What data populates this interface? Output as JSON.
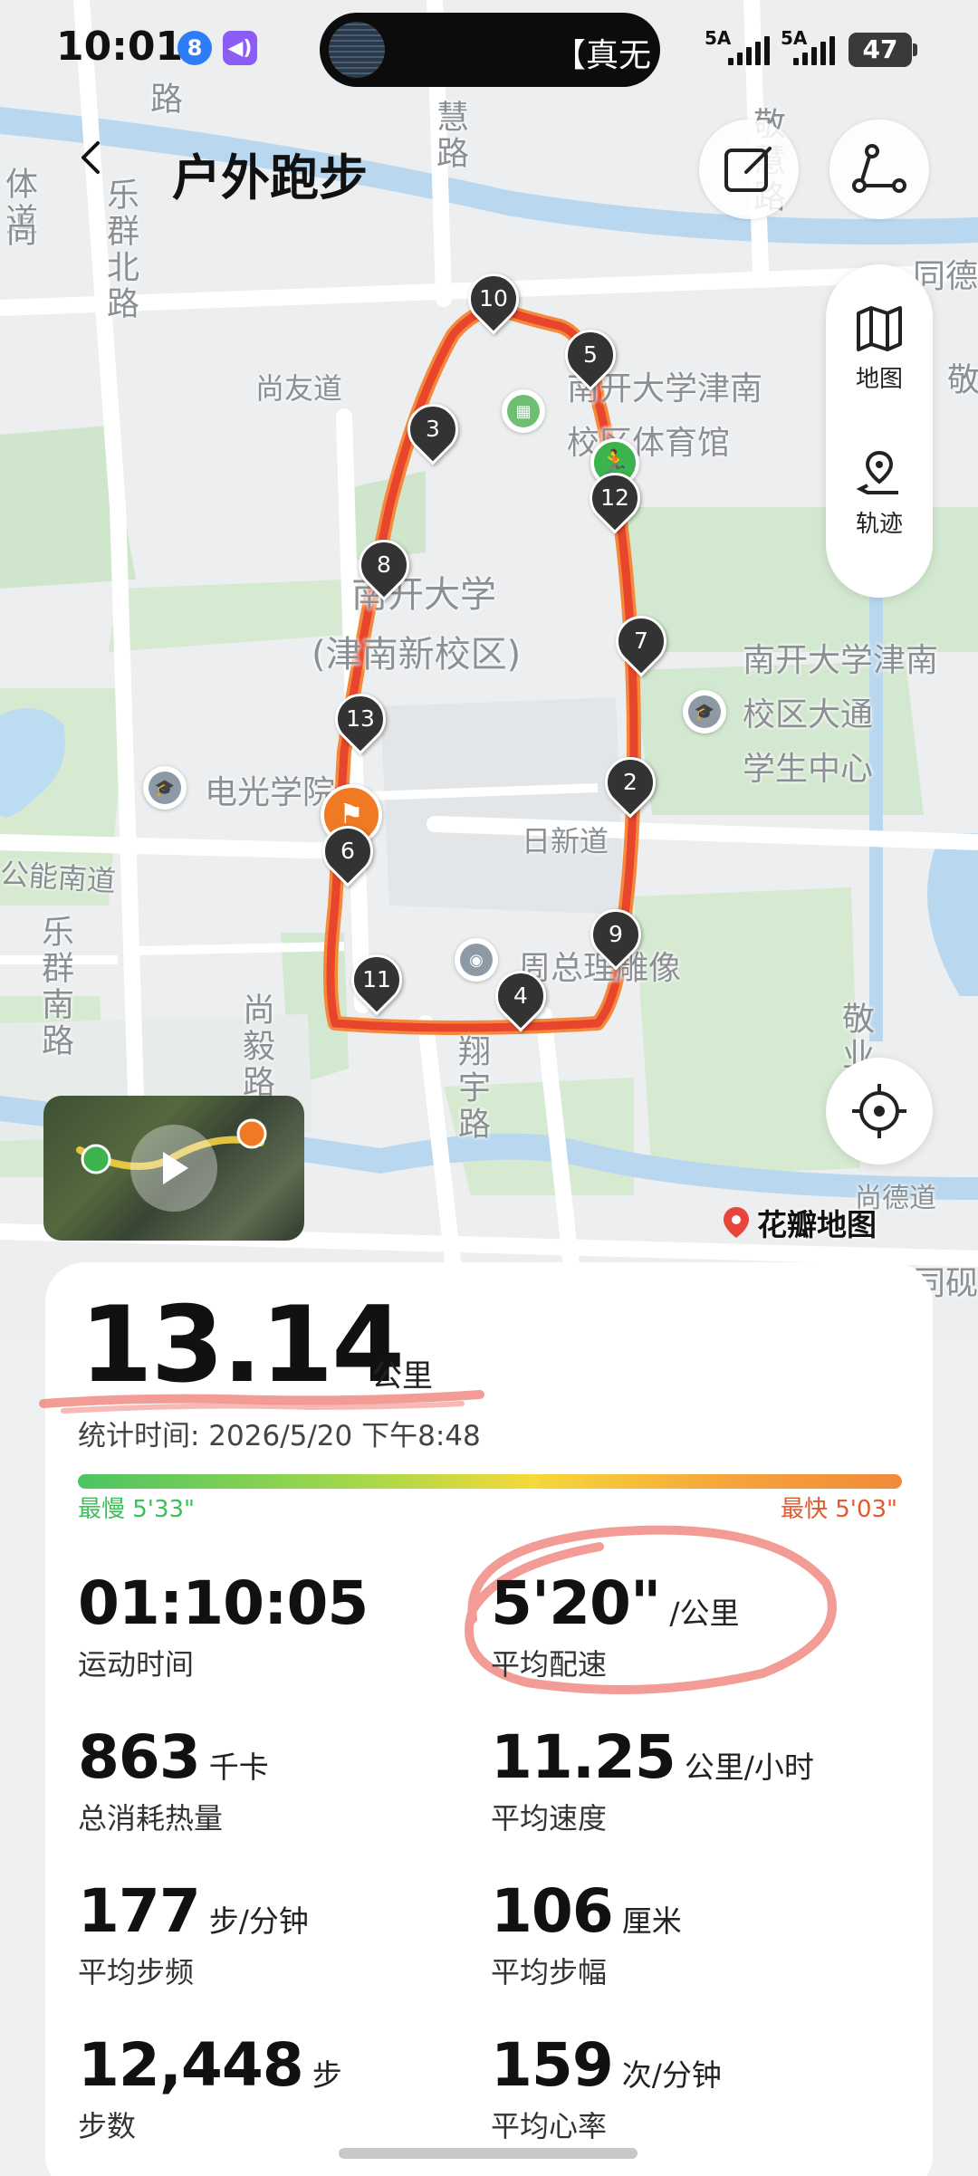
{
  "status_bar": {
    "time": "10:01",
    "badge_1": "8",
    "island_text": "【真无",
    "signal_1": "5A",
    "signal_2": "5A",
    "battery": "47"
  },
  "header": {
    "title": "户外跑步"
  },
  "map": {
    "labels": {
      "nankai_univ": "南开大学",
      "nankai_campus": "(津南新校区)",
      "gym_line1": "南开大学津南",
      "gym_line2": "校区体育馆",
      "student_center_line1": "南开大学津南",
      "student_center_line2": "校区大通",
      "student_center_line3": "学生中心",
      "dianguang": "电光学院",
      "rixin_road": "日新道",
      "statue": "周总理雕像",
      "shangyou_road": "尚友道",
      "gongneng_road": "公能南道",
      "shangde_road": "尚德道",
      "tongde_top": "同德",
      "tongyan_bottom": "同砚",
      "huisi_road": "慧路",
      "jinghui_road": "敬慧路",
      "lequn_north": "乐群北路",
      "lequn_south": "乐群南路",
      "shangyi_road": "尚毅路",
      "xiangyu_road": "翔宇路",
      "jingye_road": "敬业",
      "tiyu_road": "体道",
      "shang_left": "尚",
      "xing_road": "路",
      "jing_right": "敬"
    },
    "km_markers": [
      "10",
      "5",
      "3",
      "12",
      "8",
      "7",
      "13",
      "2",
      "9",
      "11",
      "4",
      "6"
    ],
    "side_panel": {
      "map_label": "地图",
      "track_label": "轨迹"
    },
    "brand": "花瓣地图"
  },
  "summary": {
    "distance": "13.14",
    "distance_unit": "公里",
    "stat_time": "统计时间: 2026/5/20 下午8:48",
    "pace_slowest": "最慢 5'33\"",
    "pace_fastest": "最快 5'03\""
  },
  "metrics": [
    {
      "value": "01:10:05",
      "unit": "",
      "label": "运动时间"
    },
    {
      "value": "5'20\"",
      "unit": "/公里",
      "label": "平均配速"
    },
    {
      "value": "863",
      "unit": "千卡",
      "label": "总消耗热量"
    },
    {
      "value": "11.25",
      "unit": "公里/小时",
      "label": "平均速度"
    },
    {
      "value": "177",
      "unit": "步/分钟",
      "label": "平均步频"
    },
    {
      "value": "106",
      "unit": "厘米",
      "label": "平均步幅"
    },
    {
      "value": "12,448",
      "unit": "步",
      "label": "步数"
    },
    {
      "value": "159",
      "unit": "次/分钟",
      "label": "平均心率"
    }
  ],
  "colors": {
    "route_red": "#e8452d",
    "route_orange": "#f5883a",
    "pace_slow": "#3cbf5a",
    "pace_fast": "#e05a2f",
    "annotation_red": "#f08b83"
  }
}
